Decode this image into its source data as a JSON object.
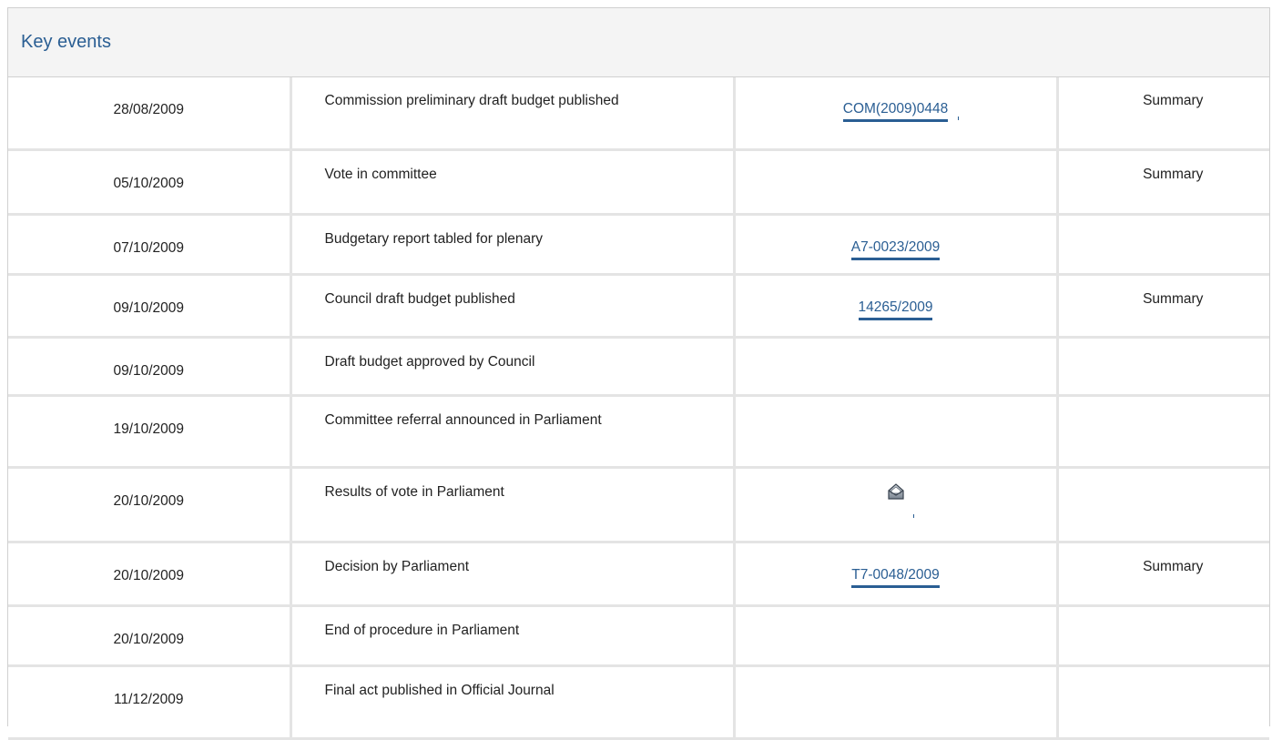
{
  "header": {
    "title": "Key events"
  },
  "rows": [
    {
      "date": "28/08/2009",
      "event": "Commission preliminary draft budget published",
      "ref": "COM(2009)0448",
      "summary": "Summary"
    },
    {
      "date": "05/10/2009",
      "event": "Vote in committee",
      "ref": "",
      "summary": "Summary"
    },
    {
      "date": "07/10/2009",
      "event": "Budgetary report tabled for plenary",
      "ref": "A7-0023/2009",
      "summary": ""
    },
    {
      "date": "09/10/2009",
      "event": "Council draft budget published",
      "ref": "14265/2009",
      "summary": "Summary"
    },
    {
      "date": "09/10/2009",
      "event": "Draft budget approved by Council",
      "ref": "",
      "summary": ""
    },
    {
      "date": "19/10/2009",
      "event": "Committee referral announced in Parliament",
      "ref": "",
      "summary": ""
    },
    {
      "date": "20/10/2009",
      "event": "Results of vote in Parliament",
      "ref_icon": "vote-results-icon",
      "summary": ""
    },
    {
      "date": "20/10/2009",
      "event": "Decision by Parliament",
      "ref": "T7-0048/2009",
      "summary": "Summary"
    },
    {
      "date": "20/10/2009",
      "event": "End of procedure in Parliament",
      "ref": "",
      "summary": ""
    },
    {
      "date": "11/12/2009",
      "event": "Final act published in Official Journal",
      "ref": "",
      "summary": ""
    }
  ],
  "colors": {
    "link": "#2a5e93",
    "header_bg": "#f4f4f4",
    "grid": "#e4e4e4"
  }
}
